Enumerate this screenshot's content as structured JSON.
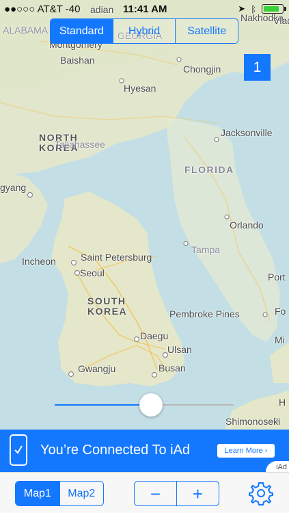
{
  "status_bar": {
    "carrier": "●●○○○ AT&T  -40",
    "time": "11:41 AM"
  },
  "map_type_control": {
    "options": [
      "Standard",
      "Hybrid",
      "Satellite"
    ],
    "selected": "Standard"
  },
  "overlay_badge": "1",
  "map_labels": {
    "north_korea": [
      "NORTH",
      "KOREA"
    ],
    "south_korea": [
      "SOUTH",
      "KOREA"
    ],
    "florida": "FLORIDA",
    "baishan": "Baishan",
    "hyesan": "Hyesan",
    "chongjin": "Chongjin",
    "jacksonville": "Jacksonville",
    "tallahassee": "Tallahassee",
    "montgomery": "Montgomery",
    "alabama": "ALABAMA",
    "georgia": "GEORGIA",
    "dadian": "adian",
    "nakhodka": "Nakhodka",
    "pyongyang": "gyang",
    "orlando": "Orlando",
    "tampa": "Tampa",
    "incheon": "Incheon",
    "saint_petersburg": "Saint Petersburg",
    "seoul": "Seoul",
    "port": "Port",
    "pembroke_pines": "Pembroke Pines",
    "fo": "Fo",
    "mi": "Mi",
    "daegu": "Daegu",
    "ulsan": "Ulsan",
    "gwangju": "Gwangju",
    "busan": "Busan",
    "shimonoseki": "Shimonoseki",
    "h": "H",
    "vladi": "Vladi"
  },
  "opacity_slider": {
    "value": 0.54
  },
  "iad_banner": {
    "headline": "You’re Connected To iAd",
    "button": "Learn More ›",
    "corner": "iAd"
  },
  "toolbar": {
    "map_selector": [
      "Map1",
      "Map2"
    ],
    "selected_map": "Map1",
    "zoom_out": "−",
    "zoom_in": "+"
  },
  "colors": {
    "accent": "#1478ff",
    "land": "#e6ead2",
    "water": "#bfdde3"
  }
}
